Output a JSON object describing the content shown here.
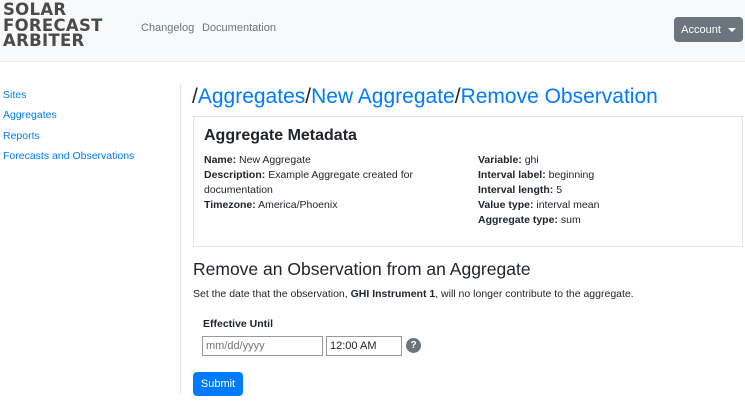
{
  "navbar": {
    "brand_lines": [
      "SOLAR",
      "FORECAST",
      "ARBITER"
    ],
    "links": [
      "Changelog",
      "Documentation"
    ],
    "account_label": "Account"
  },
  "sidebar": {
    "items": [
      {
        "label": "Sites"
      },
      {
        "label": "Aggregates"
      },
      {
        "label": "Reports"
      },
      {
        "label": "Forecasts and Observations"
      }
    ]
  },
  "breadcrumb": {
    "separator": "/",
    "items": [
      "Aggregates",
      "New Aggregate",
      "Remove Observation"
    ]
  },
  "metadata": {
    "title": "Aggregate Metadata",
    "left": [
      {
        "label": "Name:",
        "value": "New Aggregate"
      },
      {
        "label": "Description:",
        "value": "Example Aggregate created for documentation"
      },
      {
        "label": "Timezone:",
        "value": "America/Phoenix"
      }
    ],
    "right": [
      {
        "label": "Variable:",
        "value": "ghi"
      },
      {
        "label": "Interval label:",
        "value": "beginning"
      },
      {
        "label": "Interval length:",
        "value": "5"
      },
      {
        "label": "Value type:",
        "value": "interval mean"
      },
      {
        "label": "Aggregate type:",
        "value": "sum"
      }
    ]
  },
  "remove": {
    "title": "Remove an Observation from an Aggregate",
    "desc_prefix": "Set the date that the observation, ",
    "desc_observation": "GHI Instrument 1",
    "desc_suffix": ", will no longer contribute to the aggregate.",
    "effective_label": "Effective Until",
    "date_placeholder": "mm/dd/yyyy",
    "time_value": "12:00 AM",
    "help_glyph": "?",
    "help_icon": "question-circle-icon",
    "submit_label": "Submit"
  },
  "colors": {
    "link": "#007bff",
    "secondary_button": "#6c757d",
    "primary_button": "#007bff"
  }
}
